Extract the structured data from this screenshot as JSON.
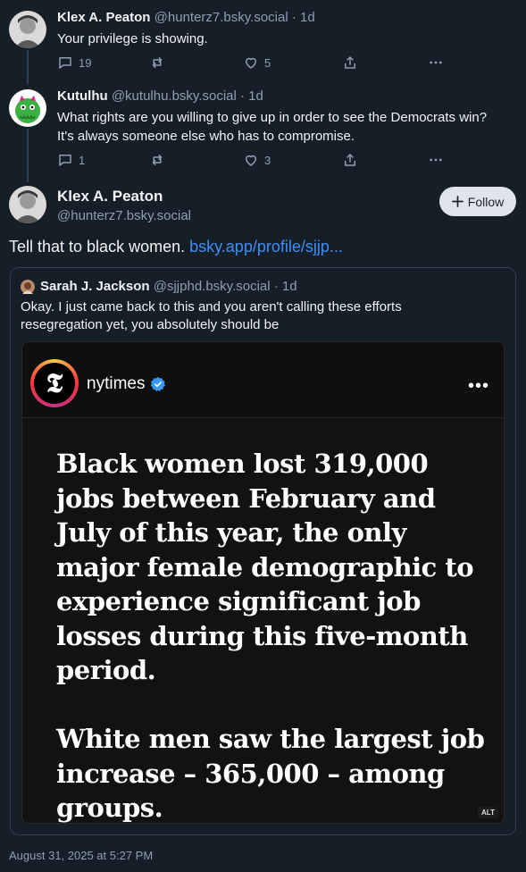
{
  "replies": [
    {
      "author_name": "Klex A. Peaton",
      "author_handle": "@hunterz7.bsky.social",
      "time": "· 1d",
      "text": "Your privilege is showing.",
      "reply_count": "19",
      "repost_count": "",
      "like_count": "5",
      "avatar_icon": "person-bw-avatar"
    },
    {
      "author_name": "Kutulhu",
      "author_handle": "@kutulhu.bsky.social",
      "time": "· 1d",
      "text": "What rights are you willing to give up in order to see the Democrats win?  It's always someone else who has to compromise.",
      "reply_count": "1",
      "repost_count": "",
      "like_count": "3",
      "avatar_icon": "green-monster-avatar"
    }
  ],
  "main_post": {
    "author_name": "Klex A. Peaton",
    "author_handle": "@hunterz7.bsky.social",
    "follow_label": "Follow",
    "text": "Tell that to black women.",
    "link_text": "bsky.app/profile/sjjp...",
    "timestamp": "August 31, 2025 at 5:27 PM"
  },
  "quote": {
    "author_name": "Sarah J. Jackson",
    "author_handle": "@sjjphd.bsky.social",
    "time": "· 1d",
    "text": "Okay. I just came back to this and you aren't calling these efforts resegregation yet, you absolutely should be",
    "embed": {
      "account": "nytimes",
      "logo_letter": "𝕿",
      "paragraph_1": "Black women lost 319,000 jobs between February and July of this year, the only major female demographic to experience significant job losses during this five-month period.",
      "paragraph_2": "White men saw the largest job increase – 365,000 – among groups.",
      "alt_label": "ALT"
    }
  },
  "colors": {
    "background": "#161e27",
    "muted_text": "#8d9fb2",
    "link": "#3d8ff4",
    "verified": "#3897f0"
  }
}
